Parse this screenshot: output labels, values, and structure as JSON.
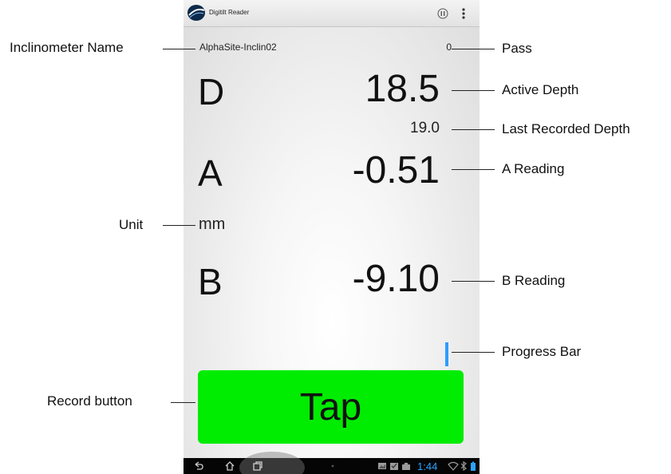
{
  "app": {
    "title": "Digitilt Reader",
    "accent_color": "#2e9cff",
    "button_color": "#00ec00"
  },
  "readings": {
    "inclinometer_name": "AlphaSite-Inclin02",
    "pass": "0",
    "depth_label": "D",
    "active_depth": "18.5",
    "last_recorded_depth": "19.0",
    "a_label": "A",
    "a_reading": "-0.51",
    "unit": "mm",
    "b_label": "B",
    "b_reading": "-9.10",
    "progress_fraction": 1.0
  },
  "record_button": {
    "label": "Tap"
  },
  "system_bar": {
    "clock": "1:44"
  },
  "callouts": {
    "inclinometer_name": "Inclinometer Name",
    "pass": "Pass",
    "active_depth": "Active Depth",
    "last_recorded_depth": "Last Recorded Depth",
    "a_reading": "A Reading",
    "unit": "Unit",
    "b_reading": "B Reading",
    "progress_bar": "Progress Bar",
    "record_button": "Record button"
  }
}
